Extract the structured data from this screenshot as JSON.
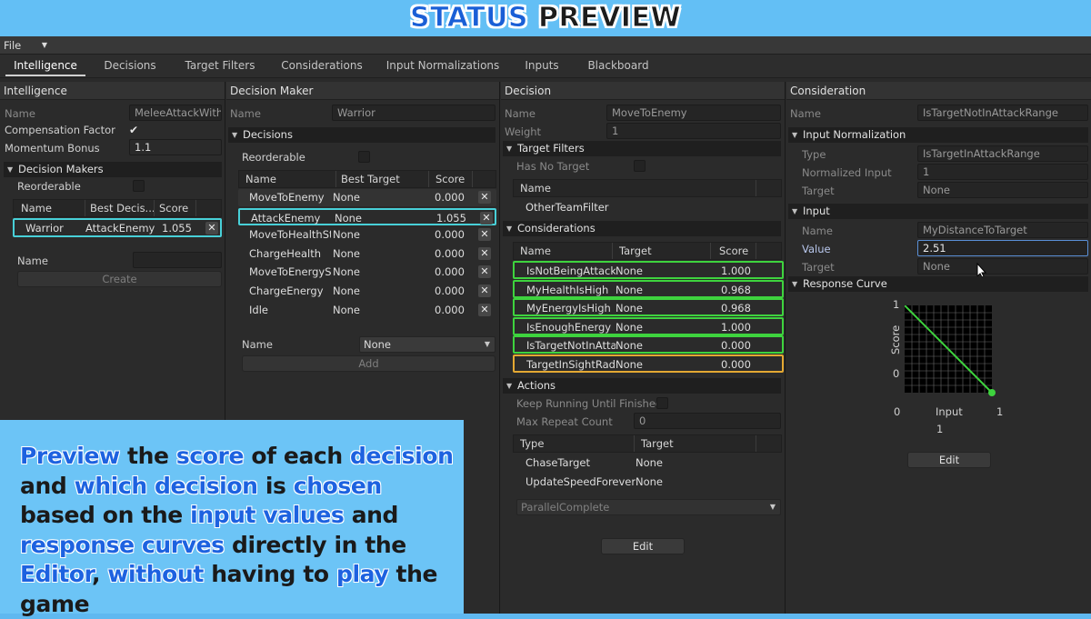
{
  "banner": {
    "word1": "STATUS",
    "word2": "PREVIEW"
  },
  "menu": {
    "file": "File"
  },
  "tabs": [
    "Intelligence",
    "Decisions",
    "Target Filters",
    "Considerations",
    "Input Normalizations",
    "Inputs",
    "Blackboard"
  ],
  "intelligence": {
    "header": "Intelligence",
    "name_label": "Name",
    "name_value": "MeleeAttackWithc",
    "compensation_label": "Compensation Factor",
    "momentum_label": "Momentum Bonus",
    "momentum_value": "1.1",
    "decision_makers_label": "Decision Makers",
    "reorderable_label": "Reorderable",
    "columns": [
      "Name",
      "Best Decis...",
      "Score"
    ],
    "rows": [
      {
        "name": "Warrior",
        "best": "AttackEnemy",
        "score": "1.055"
      }
    ],
    "new_name_label": "Name",
    "create_label": "Create"
  },
  "decision_maker": {
    "header": "Decision Maker",
    "name_label": "Name",
    "name_value": "Warrior",
    "decisions_label": "Decisions",
    "reorderable_label": "Reorderable",
    "columns": [
      "Name",
      "Best Target",
      "Score"
    ],
    "rows": [
      {
        "name": "MoveToEnemy",
        "target": "None",
        "score": "0.000"
      },
      {
        "name": "AttackEnemy",
        "target": "None",
        "score": "1.055"
      },
      {
        "name": "MoveToHealthSta",
        "target": "None",
        "score": "0.000"
      },
      {
        "name": "ChargeHealth",
        "target": "None",
        "score": "0.000"
      },
      {
        "name": "MoveToEnergySt",
        "target": "None",
        "score": "0.000"
      },
      {
        "name": "ChargeEnergy",
        "target": "None",
        "score": "0.000"
      },
      {
        "name": "Idle",
        "target": "None",
        "score": "0.000"
      }
    ],
    "add_name_label": "Name",
    "add_dropdown": "None",
    "add_label": "Add"
  },
  "decision": {
    "header": "Decision",
    "name_label": "Name",
    "name_value": "MoveToEnemy",
    "weight_label": "Weight",
    "weight_value": "1",
    "target_filters_label": "Target Filters",
    "has_no_target_label": "Has No Target",
    "filter_column": "Name",
    "filters": [
      "OtherTeamFilter"
    ],
    "considerations_label": "Considerations",
    "cons_columns": [
      "Name",
      "Target",
      "Score"
    ],
    "considerations": [
      {
        "name": "IsNotBeingAttacke",
        "target": "None",
        "score": "1.000"
      },
      {
        "name": "MyHealthIsHigh",
        "target": "None",
        "score": "0.968"
      },
      {
        "name": "MyEnergyIsHigh",
        "target": "None",
        "score": "0.968"
      },
      {
        "name": "IsEnoughEnergy",
        "target": "None",
        "score": "1.000"
      },
      {
        "name": "IsTargetNotInAttac",
        "target": "None",
        "score": "0.000"
      },
      {
        "name": "TargetInSightRadi",
        "target": "None",
        "score": "0.000"
      }
    ],
    "actions_label": "Actions",
    "keep_running_label": "Keep Running Until Finished",
    "max_repeat_label": "Max Repeat Count",
    "max_repeat_value": "0",
    "action_columns": [
      "Type",
      "Target"
    ],
    "actions": [
      {
        "type": "ChaseTarget",
        "target": "None"
      },
      {
        "type": "UpdateSpeedForever",
        "target": "None"
      }
    ],
    "execution_dropdown": "ParallelComplete",
    "edit_label": "Edit"
  },
  "consideration": {
    "header": "Consideration",
    "name_label": "Name",
    "name_value": "IsTargetNotInAttackRange",
    "input_norm_label": "Input Normalization",
    "type_label": "Type",
    "type_value": "IsTargetInAttackRange",
    "normalized_input_label": "Normalized Input",
    "normalized_input_value": "1",
    "target_label": "Target",
    "target_value": "None",
    "input_label": "Input",
    "input_name_label": "Name",
    "input_name_value": "MyDistanceToTarget",
    "value_label": "Value",
    "value_value": "2.51",
    "input_target_label": "Target",
    "input_target_value": "None",
    "response_curve_label": "Response Curve",
    "curve": {
      "y_axis": "Score",
      "x_axis": "Input",
      "y_max": "1",
      "y_min": "0",
      "x_min": "0",
      "x_max": "1",
      "current_input": "1",
      "line_color": "#3ed33e"
    },
    "edit_label": "Edit"
  },
  "callout": {
    "segments": [
      {
        "t": "Preview",
        "hl": true
      },
      {
        "t": " the ",
        "hl": false
      },
      {
        "t": "score",
        "hl": true
      },
      {
        "t": " of each ",
        "hl": false
      },
      {
        "t": "decision",
        "hl": true
      },
      {
        "t": " and ",
        "hl": false
      },
      {
        "t": "which decision",
        "hl": true
      },
      {
        "t": " is ",
        "hl": false
      },
      {
        "t": "chosen",
        "hl": true
      },
      {
        "t": " based on the ",
        "hl": false
      },
      {
        "t": "input values",
        "hl": true
      },
      {
        "t": " and ",
        "hl": false
      },
      {
        "t": "response curves",
        "hl": true
      },
      {
        "t": " directly in the ",
        "hl": false
      },
      {
        "t": "Editor",
        "hl": true
      },
      {
        "t": ", ",
        "hl": false
      },
      {
        "t": "without",
        "hl": true
      },
      {
        "t": " having to ",
        "hl": false
      },
      {
        "t": "play",
        "hl": true
      },
      {
        "t": " the game",
        "hl": false
      }
    ]
  },
  "colors": {
    "cyan_select": "#48d0d8",
    "green_select": "#3ed33e",
    "orange_select": "#e4a832",
    "highlight_text": "#1d62e0"
  }
}
